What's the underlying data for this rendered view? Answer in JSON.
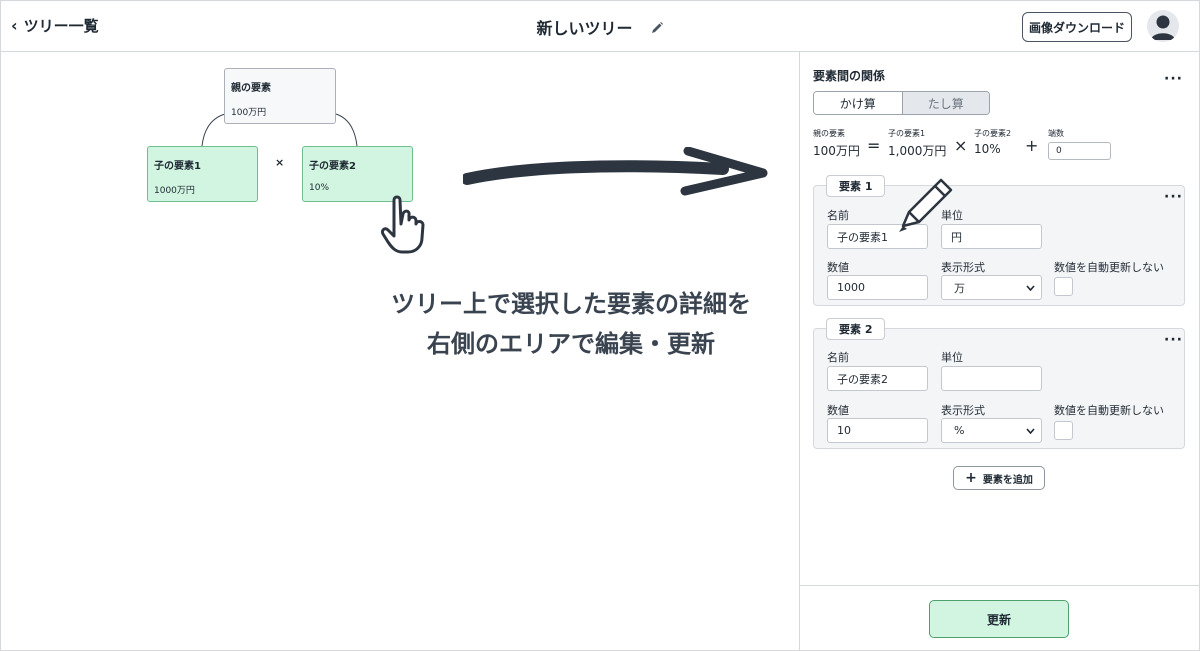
{
  "header": {
    "back_label": "ツリー一覧",
    "title": "新しいツリー",
    "download_label": "画像ダウンロード"
  },
  "canvas": {
    "parent_node": {
      "name": "親の要素",
      "value": "100万円"
    },
    "child_nodes": [
      {
        "name": "子の要素1",
        "value": "1000万円"
      },
      {
        "name": "子の要素2",
        "value": "10%"
      }
    ],
    "operator": "×",
    "caption_line1": "ツリー上で選択した要素の詳細を",
    "caption_line2": "右側のエリアで編集・更新"
  },
  "panel": {
    "title": "要素間の関係",
    "more_label": "···",
    "tabs": [
      {
        "label": "かけ算",
        "active": true
      },
      {
        "label": "たし算",
        "active": false
      }
    ],
    "formula": {
      "result_label": "親の要素",
      "result_value": "100万円",
      "eq": "=",
      "a_label": "子の要素1",
      "a_value": "1,000万円",
      "times": "×",
      "b_label": "子の要素2",
      "b_value": "10%",
      "plus": "+",
      "remainder_label": "端数",
      "remainder_value": "0"
    },
    "elements": [
      {
        "tag": "要素 1",
        "name_label": "名前",
        "name_value": "子の要素1",
        "unit_label": "単位",
        "unit_value": "円",
        "number_label": "数値",
        "number_value": "1000",
        "format_label": "表示形式",
        "format_value": "万",
        "auto_label": "数値を自動更新しない"
      },
      {
        "tag": "要素 2",
        "name_label": "名前",
        "name_value": "子の要素2",
        "unit_label": "単位",
        "unit_value": "",
        "number_label": "数値",
        "number_value": "10",
        "format_label": "表示形式",
        "format_value": "%",
        "auto_label": "数値を自動更新しない"
      }
    ],
    "add_label": "要素を追加",
    "update_label": "更新"
  }
}
